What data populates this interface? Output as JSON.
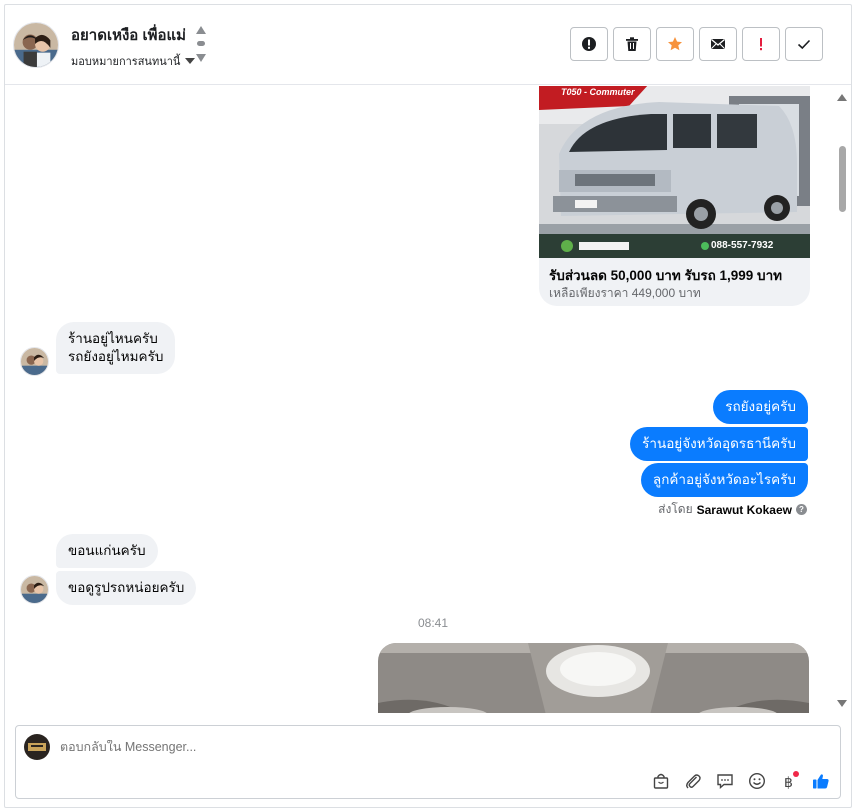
{
  "header": {
    "contact_name": "อยาดเหงือ เพื่อแม่",
    "assignment_label": "มอบหมายการสนทนานี้",
    "toolbar": [
      {
        "name": "report-spam-button",
        "icon": "exclamation-circle-icon"
      },
      {
        "name": "delete-button",
        "icon": "trash-icon"
      },
      {
        "name": "star-button",
        "icon": "star-icon",
        "color": "#f7923b"
      },
      {
        "name": "mark-unread-button",
        "icon": "envelope-icon"
      },
      {
        "name": "important-button",
        "icon": "exclamation-icon",
        "color": "#e41e3f"
      },
      {
        "name": "mark-done-button",
        "icon": "check-icon"
      }
    ]
  },
  "messages": {
    "card": {
      "title": "รับส่วนลด 50,000 บาท รับรถ 1,999 บาท",
      "subtitle": "เหลือเพียงราคา 449,000 บาท",
      "image_phone": "088-557-7932",
      "image_banner": "T050 - Commuter"
    },
    "incoming_1": [
      "ร้านอยู่ไหนครับ",
      "รถยังอยู่ไหมครับ"
    ],
    "outgoing": [
      "รถยังอยู่ครับ",
      "ร้านอยู่จังหวัดอุดรธานีครับ",
      "ลูกค้าอยู่จังหวัดอะไรครับ"
    ],
    "sent_by_prefix": "ส่งโดย",
    "sent_by_name": "Sarawut Kokaew",
    "incoming_2": [
      "ขอนแก่นครับ",
      "ขอดูรูปรถหน่อยครับ"
    ],
    "timestamp": "08:41"
  },
  "composer": {
    "placeholder": "ตอบกลับใน Messenger...",
    "icons": [
      "shopping-bag-icon",
      "paperclip-icon",
      "saved-reply-icon",
      "emoji-icon",
      "baht-payment-icon",
      "thumbs-up-icon"
    ]
  },
  "colors": {
    "outgoing_bubble": "#0a7cff",
    "incoming_bubble": "#f0f2f5",
    "like_button": "#0a7cff"
  }
}
